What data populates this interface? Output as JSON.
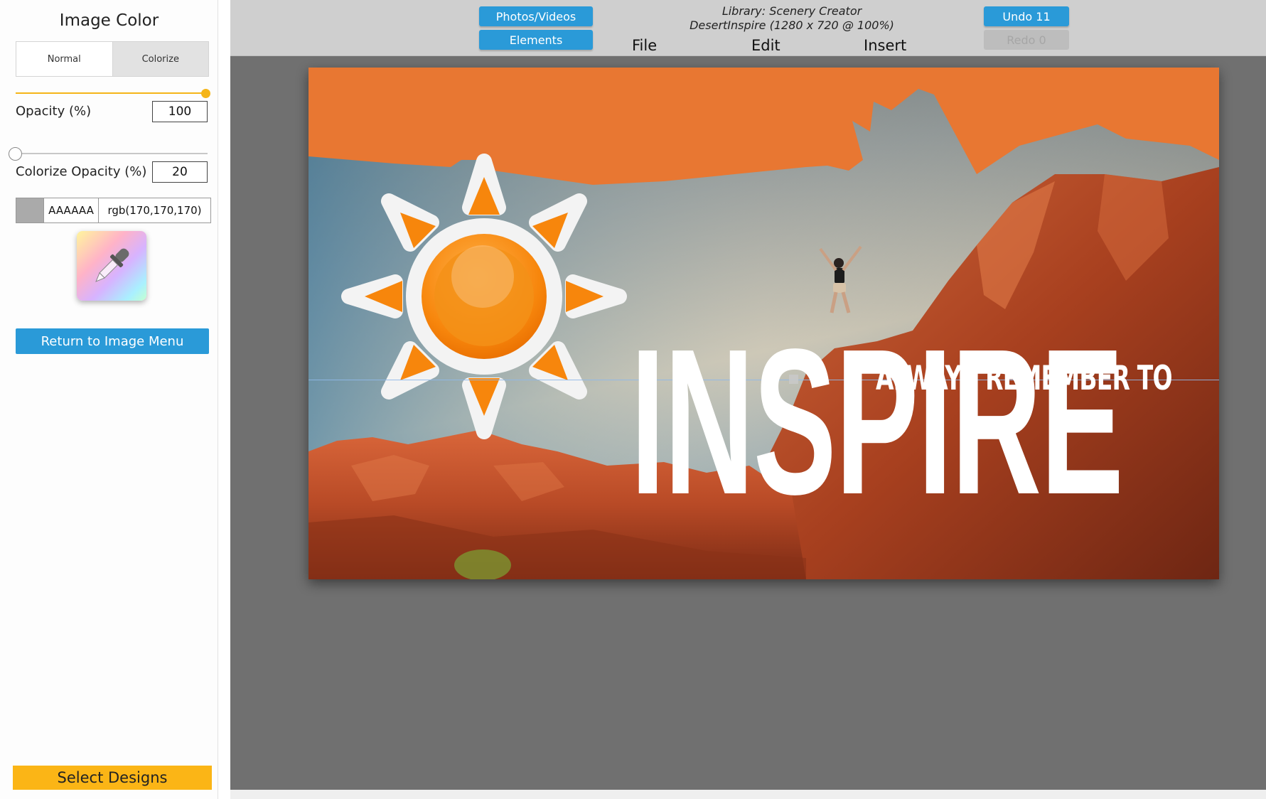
{
  "left_panel": {
    "title": "Image Color",
    "modes": {
      "normal": "Normal",
      "colorize": "Colorize",
      "active": "Colorize"
    },
    "opacity": {
      "label": "Opacity (%)",
      "value": "100",
      "level_percent": 100
    },
    "colorize_opacity": {
      "label": "Colorize Opacity (%)",
      "value": "20",
      "level_percent": 0
    },
    "color": {
      "swatch": "#aaaaaa",
      "hex": "AAAAAA",
      "rgb": "rgb(170,170,170)"
    },
    "eyedropper_icon": "eyedropper-icon",
    "return_button": "Return to Image Menu",
    "select_designs_button": "Select Designs"
  },
  "top_bar": {
    "photos_button": "Photos/Videos",
    "elements_button": "Elements",
    "library": "Library: Scenery Creator",
    "document": "DesertInspire (1280 x 720 @ 100%)",
    "menu": {
      "file": "File",
      "edit": "Edit",
      "insert": "Insert"
    },
    "undo": "Undo 11",
    "redo": "Redo 0"
  },
  "canvas": {
    "subtitle": "ALWAYS REMEMBER TO",
    "title": "INSPIRE",
    "sun_icon": "sun-icon",
    "colors": {
      "header": "#e87732",
      "rock": "#c4512a",
      "sun": "#f7860c"
    }
  }
}
